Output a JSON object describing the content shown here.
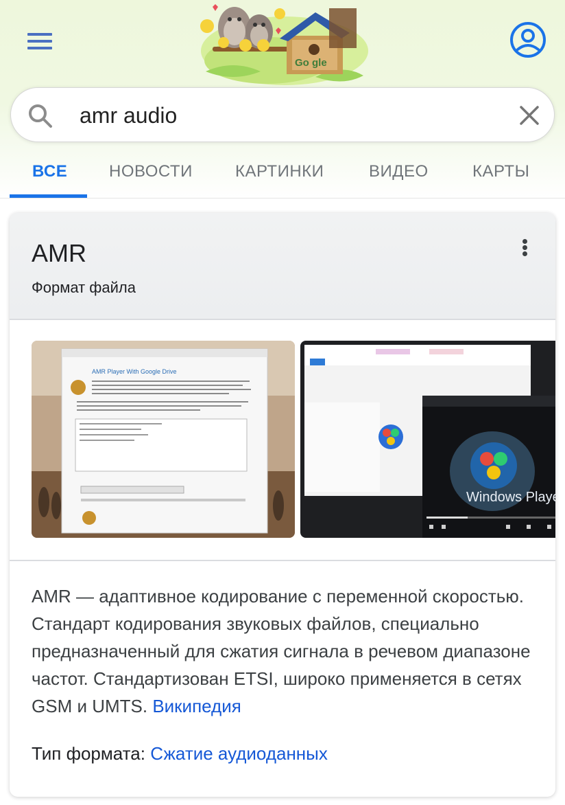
{
  "search": {
    "query": "amr audio"
  },
  "tabs": [
    {
      "label": "ВСЕ"
    },
    {
      "label": "НОВОСТИ"
    },
    {
      "label": "КАРТИНКИ"
    },
    {
      "label": "ВИДЕО"
    },
    {
      "label": "КАРТЫ"
    }
  ],
  "knowledge_panel": {
    "title": "AMR",
    "subtitle": "Формат файла",
    "images": [
      {
        "caption": "AMR Player With Google Drive"
      },
      {
        "caption": "Windows Player"
      }
    ],
    "description": "AMR — адаптивное кодирование с переменной скоростью. Стандарт кодирования звуковых файлов, специально предназначенный для сжатия сигнала в речевом диапазоне частот. Стандартизован ETSI, широко применяется в сетях GSM и UMTS.",
    "source_link": "Википедия",
    "format_type_label": "Тип формата:",
    "format_type_value": "Сжатие аудиоданных"
  },
  "colors": {
    "accent": "#1a73e8",
    "link": "#1558d6",
    "header_bg": "#eef7dc"
  }
}
